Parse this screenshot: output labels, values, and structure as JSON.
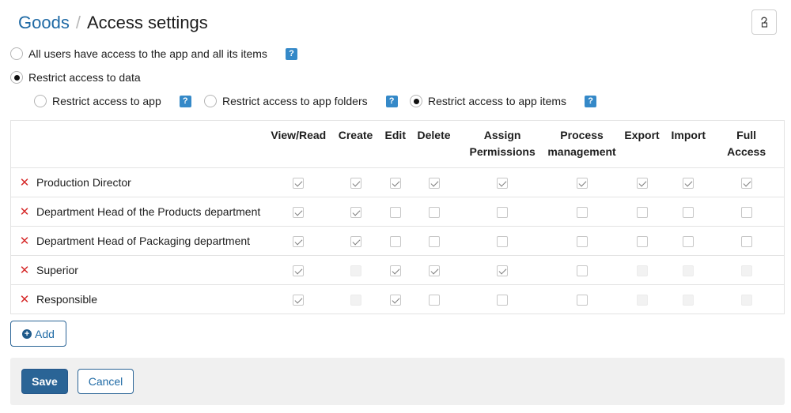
{
  "header": {
    "app_name": "Goods",
    "separator": "/",
    "title": "Access settings"
  },
  "icons": {
    "help": "question-icon",
    "remove": "close-icon",
    "add": "plus-circle-icon"
  },
  "colors": {
    "brand": "#1f6aa5",
    "primary_button": "#2a6496",
    "help_badge": "#3589c8",
    "remove": "#d62b2b"
  },
  "access_options": {
    "all_users": {
      "label": "All users have access to the app and all its items",
      "selected": false,
      "help": "?"
    },
    "restrict": {
      "label": "Restrict access to data",
      "selected": true
    }
  },
  "restrict_options": [
    {
      "label": "Restrict access to app",
      "selected": false,
      "help": "?"
    },
    {
      "label": "Restrict access to app folders",
      "selected": false,
      "help": "?"
    },
    {
      "label": "Restrict access to app items",
      "selected": true,
      "help": "?"
    }
  ],
  "table": {
    "columns": [
      {
        "line1": "View/Read",
        "line2": ""
      },
      {
        "line1": "Create",
        "line2": ""
      },
      {
        "line1": "Edit",
        "line2": ""
      },
      {
        "line1": "Delete",
        "line2": ""
      },
      {
        "line1": "Assign",
        "line2": "Permissions"
      },
      {
        "line1": "Process",
        "line2": "management"
      },
      {
        "line1": "Export",
        "line2": ""
      },
      {
        "line1": "Import",
        "line2": ""
      },
      {
        "line1": "Full",
        "line2": "Access"
      }
    ],
    "rows": [
      {
        "role": "Production Director",
        "perms": [
          "checked",
          "checked",
          "checked",
          "checked",
          "checked",
          "checked",
          "checked",
          "checked",
          "checked"
        ]
      },
      {
        "role": "Department Head of the Products department",
        "perms": [
          "checked",
          "checked",
          "unchecked",
          "unchecked",
          "unchecked",
          "unchecked",
          "unchecked",
          "unchecked",
          "unchecked"
        ]
      },
      {
        "role": "Department Head of Packaging department",
        "perms": [
          "checked",
          "checked",
          "unchecked",
          "unchecked",
          "unchecked",
          "unchecked",
          "unchecked",
          "unchecked",
          "unchecked"
        ]
      },
      {
        "role": "Superior",
        "perms": [
          "checked",
          "disabled",
          "checked",
          "checked",
          "checked",
          "unchecked",
          "disabled",
          "disabled",
          "disabled"
        ]
      },
      {
        "role": "Responsible",
        "perms": [
          "checked",
          "disabled",
          "checked",
          "unchecked",
          "unchecked",
          "unchecked",
          "disabled",
          "disabled",
          "disabled"
        ]
      }
    ]
  },
  "buttons": {
    "add": "Add",
    "save": "Save",
    "cancel": "Cancel"
  }
}
